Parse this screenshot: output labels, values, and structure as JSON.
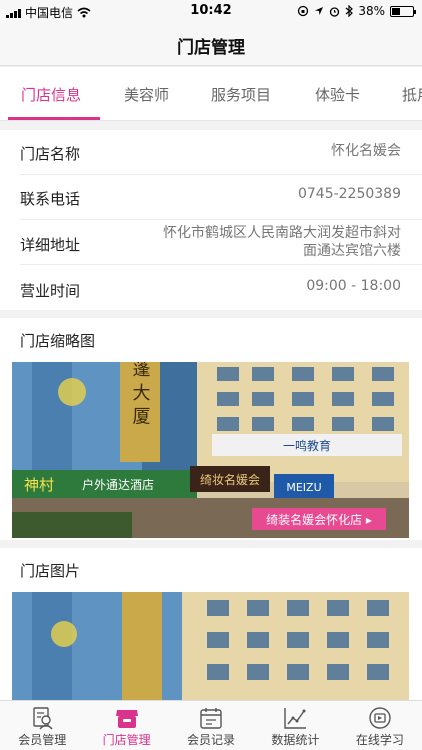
{
  "status_bar": {
    "carrier": "中国电信",
    "time": "10:42",
    "battery_percent": "38%",
    "battery_level": 0.38
  },
  "nav": {
    "title": "门店管理"
  },
  "tabs": [
    {
      "label": "门店信息",
      "active": true
    },
    {
      "label": "美容师",
      "active": false
    },
    {
      "label": "服务项目",
      "active": false
    },
    {
      "label": "体验卡",
      "active": false
    },
    {
      "label": "抵用",
      "active": false
    }
  ],
  "info": {
    "name_label": "门店名称",
    "name_value": "怀化名媛会",
    "phone_label": "联系电话",
    "phone_value": "0745-2250389",
    "address_label": "详细地址",
    "address_line1": "怀化市鹤城区人民南路大润发超市斜对",
    "address_line2": "面通达宾馆六楼",
    "hours_label": "营业时间",
    "hours_value": "09:00 - 18:00"
  },
  "thumbnail_section": {
    "title": "门店缩略图",
    "banner_text": "绮装名媛会怀化店 ▸",
    "sign_hotel": "户外通达酒店",
    "sign_left": "神村",
    "sign_big": "蓬 大 厦",
    "sign_shop": "绮妆名媛会",
    "sign_edu": "一鸣教育",
    "sign_meizu": "MEIZU"
  },
  "photos_section": {
    "title": "门店图片"
  },
  "tabbar": [
    {
      "label": "会员管理",
      "icon": "member-management-icon",
      "active": false
    },
    {
      "label": "门店管理",
      "icon": "store-management-icon",
      "active": true
    },
    {
      "label": "会员记录",
      "icon": "member-records-icon",
      "active": false
    },
    {
      "label": "数据统计",
      "icon": "statistics-icon",
      "active": false
    },
    {
      "label": "在线学习",
      "icon": "online-learning-icon",
      "active": false
    }
  ],
  "colors": {
    "accent": "#d9338c"
  }
}
